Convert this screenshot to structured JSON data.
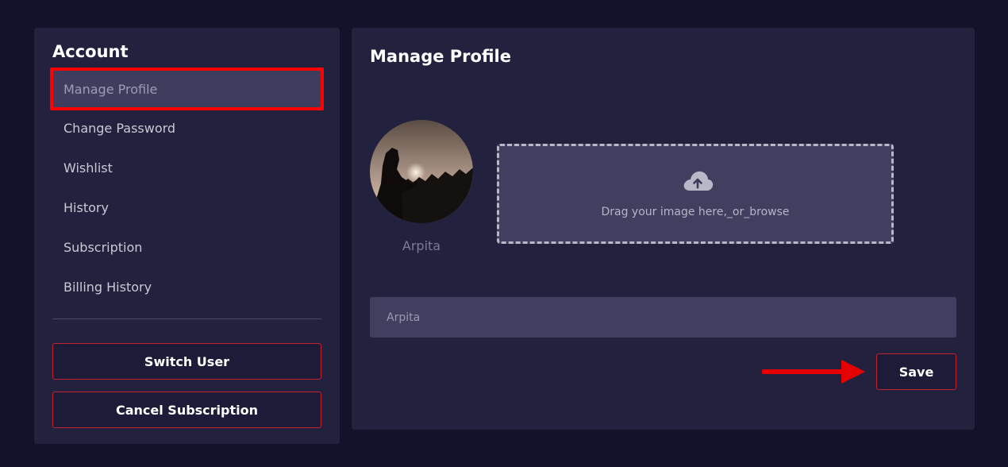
{
  "sidebar": {
    "title": "Account",
    "items": [
      {
        "label": "Manage Profile"
      },
      {
        "label": "Change Password"
      },
      {
        "label": "Wishlist"
      },
      {
        "label": "History"
      },
      {
        "label": "Subscription"
      },
      {
        "label": "Billing History"
      }
    ],
    "switch_user_label": "Switch User",
    "cancel_subscription_label": "Cancel Subscription"
  },
  "main": {
    "title": "Manage Profile",
    "avatar_name": "Arpita",
    "dropzone_text": "Drag your image here,_or_browse",
    "name_field_value": "Arpita",
    "save_label": "Save"
  },
  "colors": {
    "background": "#12132b",
    "panel": "#22223f",
    "active_item": "#3e3d5e",
    "highlight": "#ff0000",
    "button_border": "#c4212f",
    "annotation_arrow": "#e60000"
  },
  "icons": {
    "upload": "cloud-upload-icon",
    "annotation": "red-arrow-icon"
  }
}
